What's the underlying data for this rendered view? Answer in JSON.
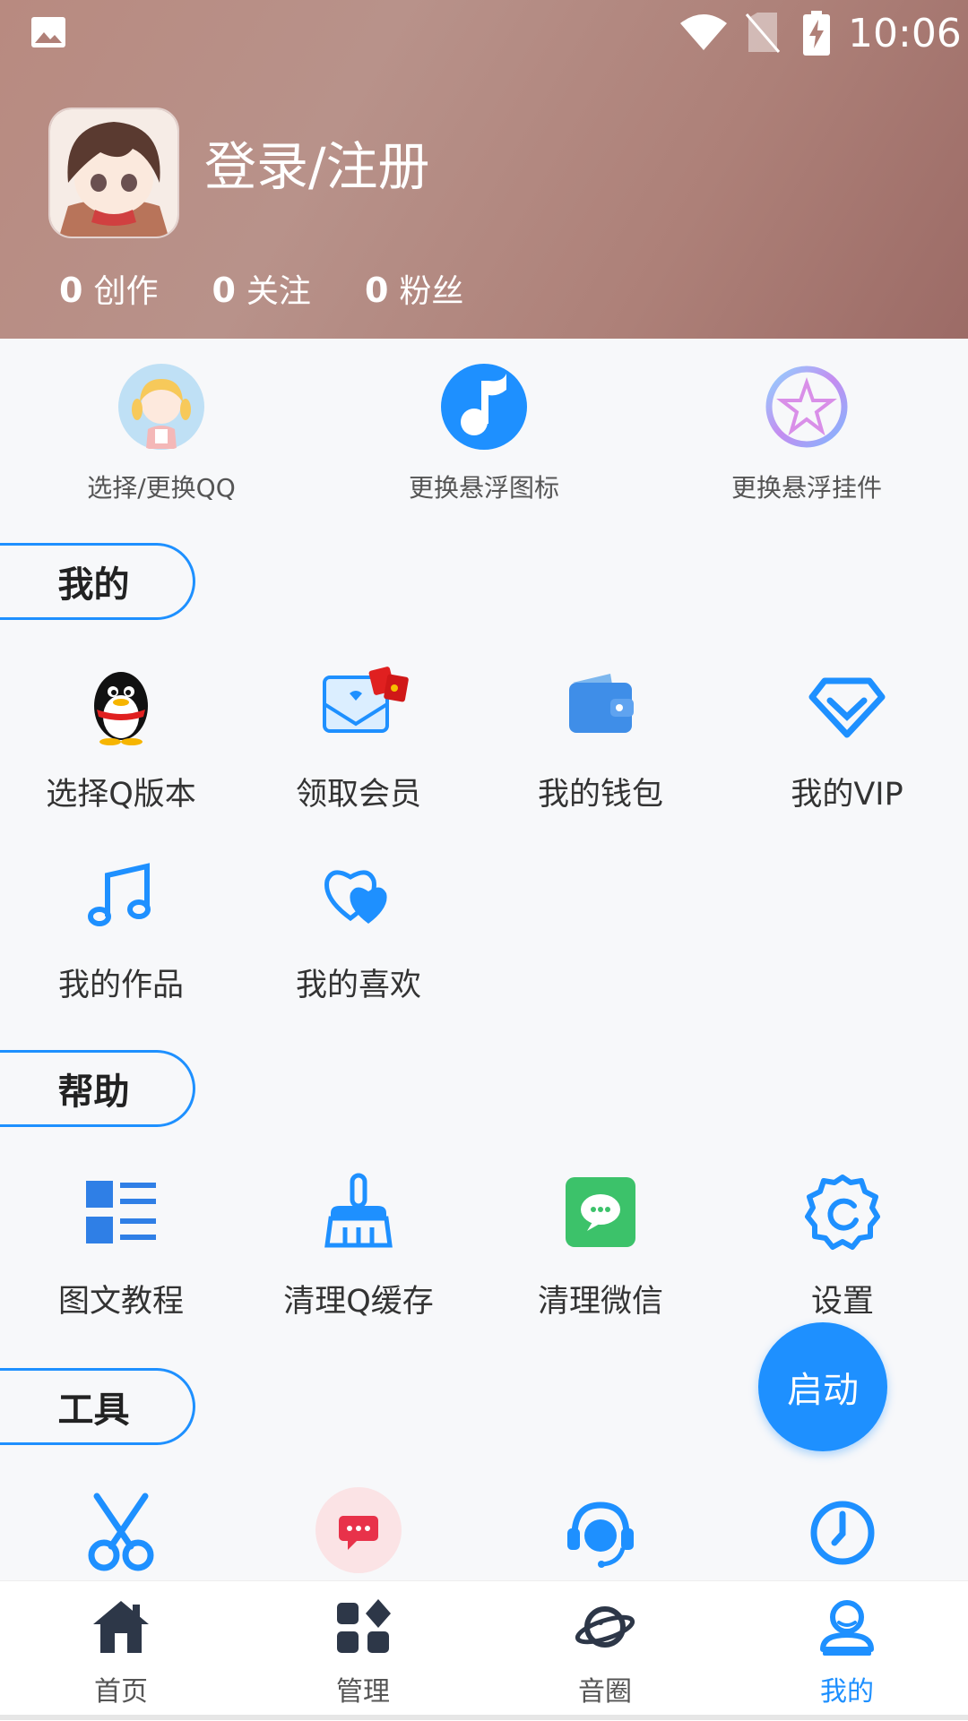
{
  "status_bar": {
    "time": "10:06"
  },
  "profile": {
    "login_label": "登录/注册",
    "stats": [
      {
        "count": "0",
        "label": "创作"
      },
      {
        "count": "0",
        "label": "关注"
      },
      {
        "count": "0",
        "label": "粉丝"
      }
    ]
  },
  "quick_actions": [
    {
      "label": "选择/更换QQ",
      "icon": "qq-avatar-icon"
    },
    {
      "label": "更换悬浮图标",
      "icon": "music-note-circle-icon"
    },
    {
      "label": "更换悬浮挂件",
      "icon": "star-pendant-icon"
    }
  ],
  "sections": {
    "mine": {
      "title": "我的",
      "items": [
        {
          "label": "选择Q版本",
          "icon": "qq-penguin-icon"
        },
        {
          "label": "领取会员",
          "icon": "envelope-redpacket-icon"
        },
        {
          "label": "我的钱包",
          "icon": "wallet-icon"
        },
        {
          "label": "我的VIP",
          "icon": "diamond-icon"
        },
        {
          "label": "我的作品",
          "icon": "music-note-icon"
        },
        {
          "label": "我的喜欢",
          "icon": "hearts-icon"
        }
      ]
    },
    "help": {
      "title": "帮助",
      "items": [
        {
          "label": "图文教程",
          "icon": "list-icon"
        },
        {
          "label": "清理Q缓存",
          "icon": "broom-icon"
        },
        {
          "label": "清理微信",
          "icon": "wechat-icon"
        },
        {
          "label": "设置",
          "icon": "gear-icon"
        }
      ]
    },
    "tools": {
      "title": "工具",
      "items": [
        {
          "icon": "scissors-icon"
        },
        {
          "icon": "message-icon"
        },
        {
          "icon": "headset-icon"
        },
        {
          "icon": "clock-icon"
        }
      ]
    }
  },
  "fab": {
    "label": "启动"
  },
  "bottom_nav": [
    {
      "label": "首页",
      "icon": "home-icon"
    },
    {
      "label": "管理",
      "icon": "grid-icon"
    },
    {
      "label": "音圈",
      "icon": "planet-icon"
    },
    {
      "label": "我的",
      "icon": "user-icon",
      "active": true
    }
  ],
  "colors": {
    "accent": "#1e90ff",
    "header": "#b08078"
  }
}
